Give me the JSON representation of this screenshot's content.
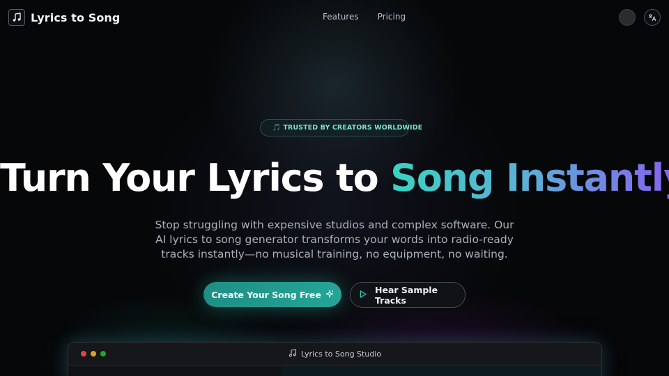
{
  "nav": {
    "brand": "Lyrics to Song",
    "links": [
      "Features",
      "Pricing"
    ]
  },
  "hero": {
    "badge": "🎵 TRUSTED BY CREATORS WORLDWIDE",
    "headline_plain": "Turn Your Lyrics to ",
    "headline_gradient": "Song Instantly",
    "subtitle": "Stop struggling with expensive studios and complex software. Our AI lyrics to song generator transforms your words into radio-ready tracks instantly—no musical training, no equipment, no waiting.",
    "primary_cta": "Create Your Song Free",
    "secondary_cta": "Hear Sample Tracks"
  },
  "studio": {
    "title": "Lyrics to Song Studio"
  },
  "colors": {
    "accent": "#25a595",
    "gradient_start": "#39d3c0",
    "gradient_end": "#8a5cf0",
    "window_red": "#e0443e",
    "window_yellow": "#dea123",
    "window_green": "#1aab29"
  }
}
